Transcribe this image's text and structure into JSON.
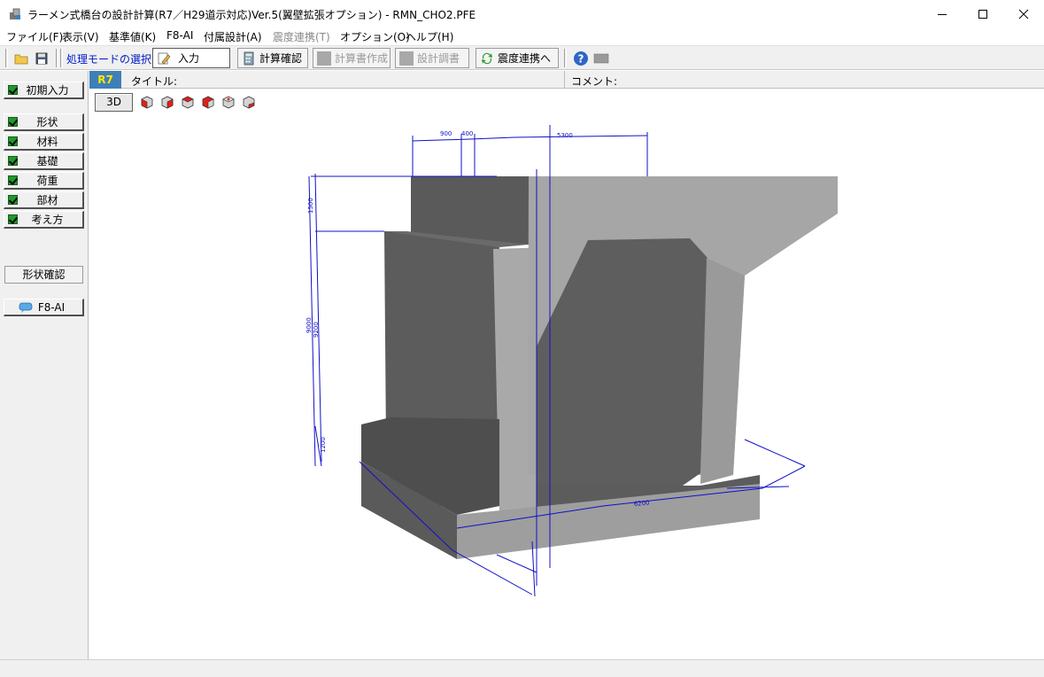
{
  "window": {
    "title": "ラーメン式橋台の設計計算(R7／H29道示対応)Ver.5(翼壁拡張オプション) - RMN_CHO2.PFE"
  },
  "menu": {
    "items": [
      {
        "label": "ファイル(F)"
      },
      {
        "label": "表示(V)"
      },
      {
        "label": "基準値(K)"
      },
      {
        "label": "F8-AI"
      },
      {
        "label": "付属設計(A)"
      },
      {
        "label": "震度連携(T)"
      },
      {
        "label": "オプション(O)"
      },
      {
        "label": "ヘルプ(H)"
      }
    ]
  },
  "toolbar": {
    "mode_label": "処理モードの選択",
    "input_label": "入力",
    "calc_check_label": "計算確認",
    "report_label": "計算書作成",
    "design_label": "設計調書",
    "seismic_label": "震度連携へ"
  },
  "sidebar": {
    "initial_input": "初期入力",
    "items": [
      {
        "label": "形状"
      },
      {
        "label": "材料"
      },
      {
        "label": "基礎"
      },
      {
        "label": "荷重"
      },
      {
        "label": "部材"
      },
      {
        "label": "考え方"
      }
    ],
    "shape_check": "形状確認",
    "f8ai": "F8-AI"
  },
  "infobar": {
    "badge": "R7",
    "title_label": "タイトル:",
    "comment_label": "コメント:"
  },
  "view": {
    "mode_3d": "3D",
    "dimensions": {
      "top_left": "900",
      "top_mid": "400",
      "top_right": "5300",
      "left_upper": "1500",
      "left_mid_a": "9000",
      "left_mid_b": "9200",
      "left_lower": "1200",
      "bottom_right": "6200"
    }
  }
}
